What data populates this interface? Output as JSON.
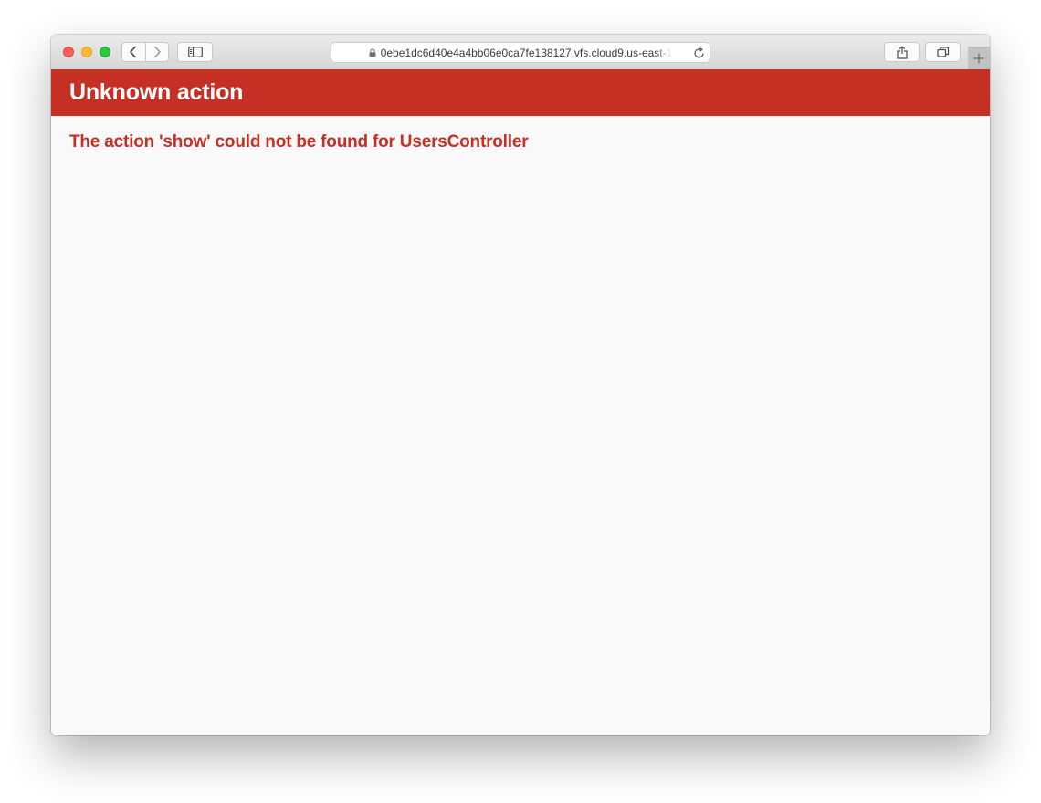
{
  "browser": {
    "url": "0ebe1dc6d40e4a4bb06e0ca7fe138127.vfs.cloud9.us-east-1",
    "icons": {
      "back": "chevron-left-icon",
      "forward": "chevron-right-icon",
      "sidebar": "sidebar-icon",
      "lock": "lock-icon",
      "reload": "reload-icon",
      "share": "share-icon",
      "tabs": "tabs-overview-icon",
      "new_tab": "plus-icon"
    },
    "traffic_colors": {
      "close": "#fe5f57",
      "minimize": "#febc2e",
      "maximize": "#28c840"
    }
  },
  "page": {
    "header_title": "Unknown action",
    "message": "The action 'show' could not be found for UsersController",
    "accent_color": "#c52f24",
    "background_color": "#f9f9f9"
  }
}
